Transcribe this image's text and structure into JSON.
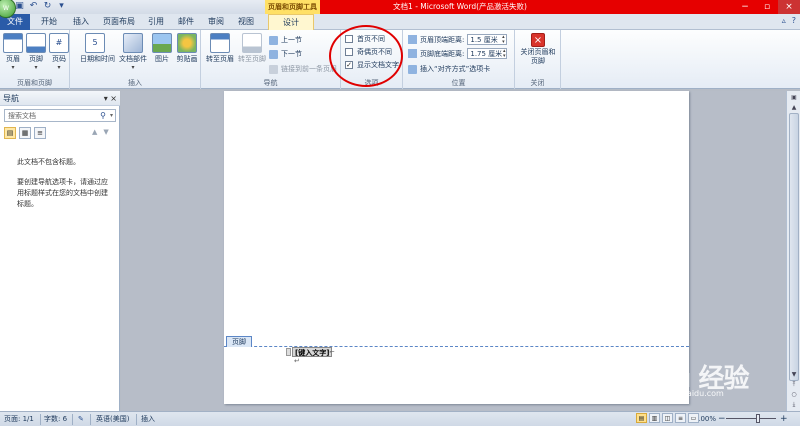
{
  "titlebar": {
    "app_logo": "W",
    "qat": [
      "save-icon",
      "undo-icon",
      "redo-icon",
      "customize-icon"
    ],
    "context_label": "页眉和页脚工具",
    "title": "文档1 - Microsoft Word(产品激活失败)",
    "win_controls": [
      "−",
      "▫",
      "×"
    ]
  },
  "tabs": {
    "file": "文件",
    "items": [
      "开始",
      "插入",
      "页面布局",
      "引用",
      "邮件",
      "审阅",
      "视图"
    ],
    "design": "设计"
  },
  "ribbon": {
    "groups": {
      "header_footer": {
        "label": "页眉和页脚",
        "buttons": [
          "页眉",
          "页脚",
          "页码"
        ]
      },
      "insert": {
        "label": "插入",
        "buttons": [
          "日期和时间",
          "文档部件",
          "图片",
          "剪贴画"
        ]
      },
      "navigation": {
        "label": "导航",
        "goto_header": "转至页眉",
        "goto_footer": "转至页脚",
        "prev": "上一节",
        "next": "下一节",
        "link_prev": "链接到前一条页眉"
      },
      "options": {
        "label": "选项",
        "checks": [
          {
            "label": "首页不同",
            "checked": false
          },
          {
            "label": "奇偶页不同",
            "checked": false
          },
          {
            "label": "显示文档文字",
            "checked": true
          }
        ]
      },
      "position": {
        "label": "位置",
        "header_dist_label": "页眉顶端距离:",
        "header_dist_value": "1.5 厘米",
        "footer_dist_label": "页脚底端距离:",
        "footer_dist_value": "1.75 厘米",
        "insert_align": "插入“对齐方式”选项卡"
      },
      "close": {
        "label": "关闭",
        "button": "关闭页眉和页脚"
      }
    }
  },
  "nav": {
    "title": "导航",
    "search_placeholder": "搜索文档",
    "msg1": "此文档不包含标题。",
    "msg2": "要创建导航选项卡，请通过应用标题样式在您的文档中创建标题。"
  },
  "document": {
    "footer_tab": "页脚",
    "footer_placeholder": "[键入文字]"
  },
  "watermark": {
    "text": "Baidu 经验",
    "url": "jingyan.baidu.com"
  },
  "status": {
    "page": "页面: 1/1",
    "words": "字数: 6",
    "language": "英语(美国)",
    "insert": "插入",
    "zoom": "100%"
  },
  "colors": {
    "context_red": "#e60000",
    "annotation_circle": "#e00000",
    "file_tab": "#2a5ba8"
  }
}
